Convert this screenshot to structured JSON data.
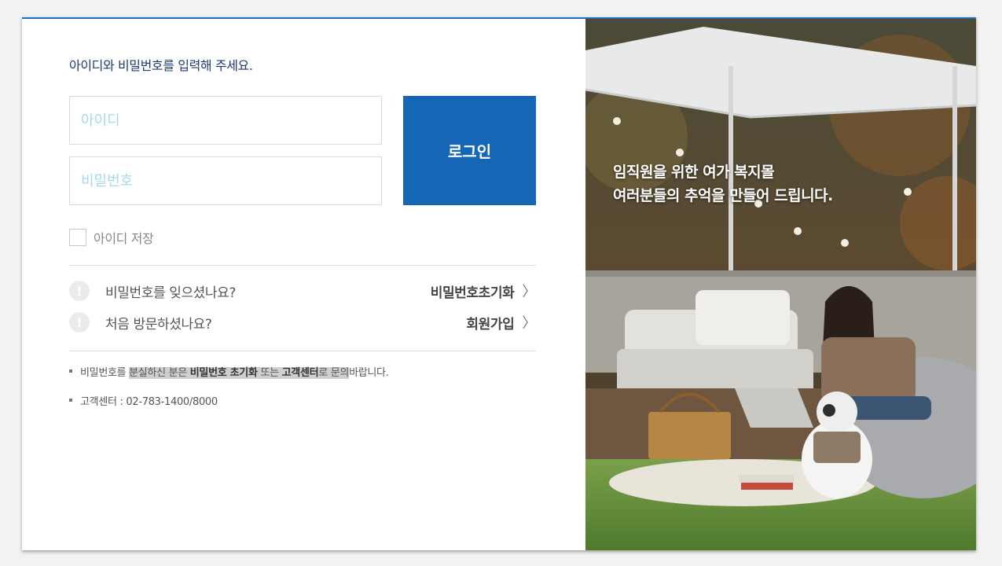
{
  "login": {
    "prompt": "아이디와 비밀번호를 입력해 주세요.",
    "id_placeholder": "아이디",
    "password_placeholder": "비밀번호",
    "login_button": "로그인",
    "save_id_label": "아이디 저장"
  },
  "help": [
    {
      "question": "비밀번호를 잊으셨나요?",
      "link": "비밀번호초기화",
      "icon": "exclamation-icon"
    },
    {
      "question": "처음 방문하셨나요?",
      "link": "회원가입",
      "icon": "exclamation-icon"
    }
  ],
  "notes": {
    "line1": {
      "p1": "비밀번호를 ",
      "p2": "분실하신 분은 ",
      "p3": "비밀번호 초기화",
      "p4": " 또는 ",
      "p5": "고객센터",
      "p6": "로 문의",
      "p7": "바랍니다."
    },
    "line2": "고객센터 : 02-783-1400/8000"
  },
  "promo": {
    "line1": "임직원을 위한 여가 복지몰",
    "line2": "여러분들의 추억을 만들어 드립니다."
  },
  "colors": {
    "accent": "#1567b5",
    "prompt_text": "#1f3b73",
    "placeholder": "#a9d8ec"
  }
}
